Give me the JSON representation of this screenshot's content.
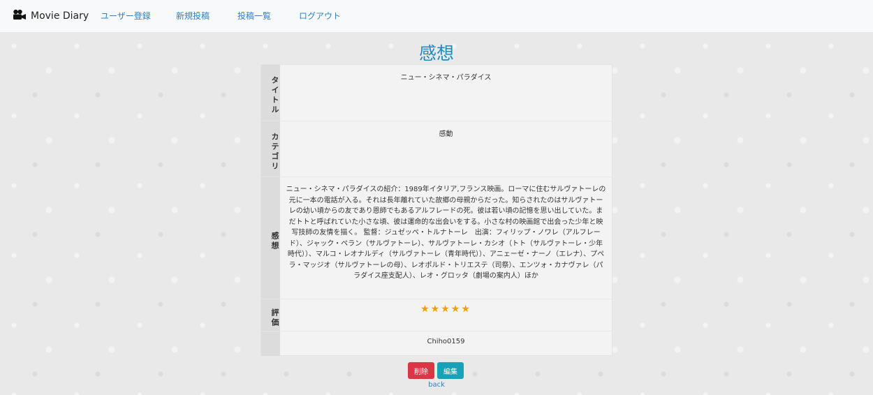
{
  "navbar": {
    "brand": "Movie Diary",
    "links": [
      "ユーザー登録",
      "新規投稿",
      "投稿一覧",
      "ログアウト"
    ]
  },
  "page": {
    "title": "感想"
  },
  "table": {
    "rows": [
      {
        "label": "タイトル",
        "value": "ニュー・シネマ・パラダイス"
      },
      {
        "label": "カテゴリ",
        "value": "感動"
      },
      {
        "label": "感想",
        "value": "ニュー・シネマ・パラダイスの紹介：1989年イタリア,フランス映画。ローマに住むサルヴァトーレの元に一本の電話が入る。それは長年離れていた故郷の母親からだった。知らされたのはサルヴァトーレの幼い頃からの友であり恩師でもあるアルフレードの死。彼は若い頃の記憶を思い出していた。まだトトと呼ばれていた小さな頃、彼は運命的な出会いをする。小さな村の映画館で出会った少年と映写技師の友情を描く。 監督：ジュゼッペ・トルナトーレ　出演：フィリップ・ノワレ（アルフレード）、ジャック・ペラン（サルヴァトーレ）、サルヴァトーレ・カシオ（トト（サルヴァトーレ・少年時代））、マルコ・レオナルディ（サルヴァトーレ（青年時代））、アニェーゼ・ナーノ（エレナ）、プペラ・マッジオ（サルヴァトーレの母）、レオポルド・トリエステ（司祭）、エンツォ・カナヴァレ（パラダイス座支配人）、レオ・グロッタ（劇場の案内人）ほか"
      },
      {
        "label": "評価",
        "value": "★★★★★",
        "rating": 5
      },
      {
        "label": "",
        "value": "Chiho0159"
      }
    ]
  },
  "actions": {
    "delete": "削除",
    "edit": "編集",
    "back": "back"
  },
  "colors": {
    "title": "#1f8cbe",
    "delete": "#dc3545",
    "edit": "#17a2b8",
    "star": "#f0a000",
    "link": "#2f7fc1"
  }
}
